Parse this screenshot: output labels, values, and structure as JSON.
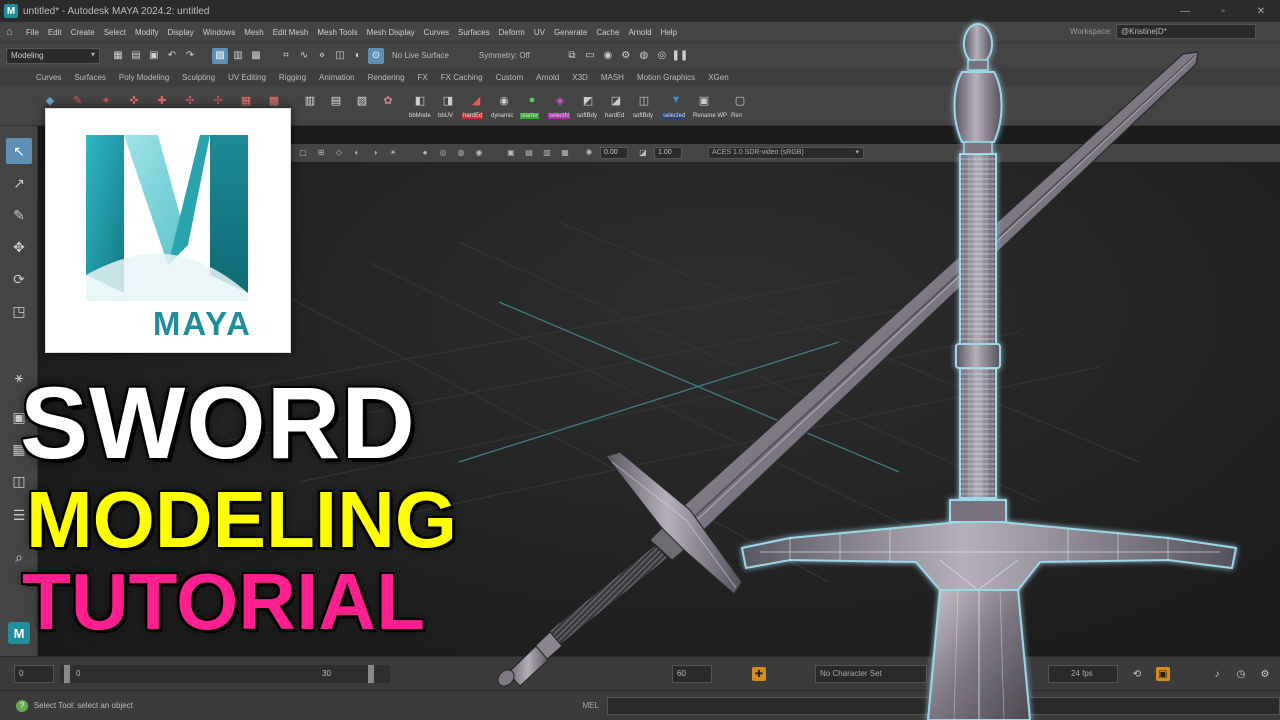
{
  "window": {
    "title": "untitled* - Autodesk MAYA 2024.2: untitled",
    "controls": [
      "—",
      "▫",
      "✕"
    ]
  },
  "menubar": {
    "items": [
      "File",
      "Edit",
      "Create",
      "Select",
      "Modify",
      "Display",
      "Windows",
      "Mesh",
      "Edit Mesh",
      "Mesh Tools",
      "Mesh Display",
      "Curves",
      "Surfaces",
      "Deform",
      "UV",
      "Generate",
      "Cache",
      "Arnold",
      "Help"
    ],
    "workspace_label": "Workspace:",
    "workspace_value": "@Kristine|D*"
  },
  "statusline": {
    "mode": "Modeling",
    "live_surface": "No Live Surface",
    "symmetry": "Symmetry: Off"
  },
  "shelf": {
    "tabs": [
      "Curves",
      "Surfaces",
      "Poly Modeling",
      "Sculpting",
      "UV Editing",
      "Rigging",
      "Animation",
      "Rendering",
      "FX",
      "FX Caching",
      "Custom",
      "Arnold",
      "X3D",
      "MASH",
      "Motion Graphics",
      "XGen"
    ],
    "labels": [
      "bbMode",
      "bbUV",
      "hardEd",
      "dynamic",
      "starter",
      "selectN",
      "softBdy",
      "hardEd",
      "softBdy",
      "selected",
      "Rename WP",
      "Ren"
    ]
  },
  "viewport": {
    "exposure": "0.00",
    "gamma": "1.00",
    "color_space": "ACES 1.0 SDR-video (sRGB)"
  },
  "timeline": {
    "start": "0",
    "range_start": "0",
    "current": "30",
    "range_end": "60",
    "character_set": "No Character Set",
    "fps": "24 fps"
  },
  "commandline": {
    "help_text": "Select Tool: select an object",
    "mel_label": "MEL"
  },
  "thumbnail": {
    "logo_text": "MAYA",
    "headline_1": "SWORD",
    "headline_2": "MODELING",
    "headline_3": "TUTORIAL"
  },
  "colors": {
    "maya_teal": "#1f8d9b",
    "headline_white": "#ffffff",
    "headline_yellow": "#ffff00",
    "headline_pink": "#ff1f8e",
    "sword_glow": "#9ad7ea",
    "ui_panel": "#444444"
  }
}
